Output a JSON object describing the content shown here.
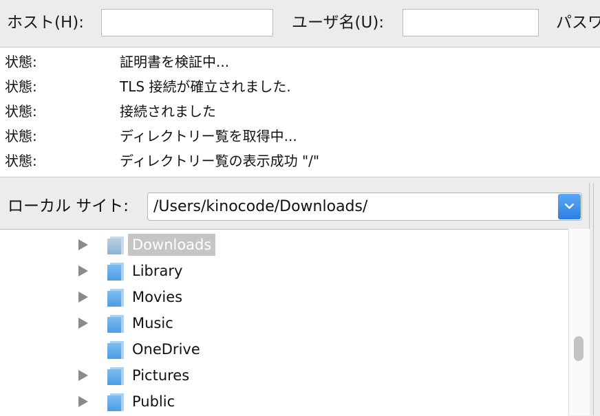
{
  "quickconnect": {
    "host_label": "ホスト(H):",
    "host_value": "",
    "user_label": "ユーザ名(U):",
    "user_value": "",
    "pass_label": "パスワ"
  },
  "log": [
    {
      "type": "状態:",
      "message": "証明書を検証中..."
    },
    {
      "type": "状態:",
      "message": "TLS 接続が確立されました."
    },
    {
      "type": "状態:",
      "message": "接続されました"
    },
    {
      "type": "状態:",
      "message": "ディレクトリー覧を取得中..."
    },
    {
      "type": "状態:",
      "message": "ディレクトリー覧の表示成功 \"/\""
    }
  ],
  "local_site": {
    "label": "ローカル サイト:",
    "path": "/Users/kinocode/Downloads/",
    "dropdown_icon": "chevron-down-icon",
    "accent_color": "#2a7fe6"
  },
  "tree": [
    {
      "name": "Downloads",
      "expandable": true,
      "selected": true
    },
    {
      "name": "Library",
      "expandable": true,
      "selected": false
    },
    {
      "name": "Movies",
      "expandable": true,
      "selected": false
    },
    {
      "name": "Music",
      "expandable": true,
      "selected": false
    },
    {
      "name": "OneDrive",
      "expandable": false,
      "selected": false
    },
    {
      "name": "Pictures",
      "expandable": true,
      "selected": false
    },
    {
      "name": "Public",
      "expandable": true,
      "selected": false
    }
  ]
}
